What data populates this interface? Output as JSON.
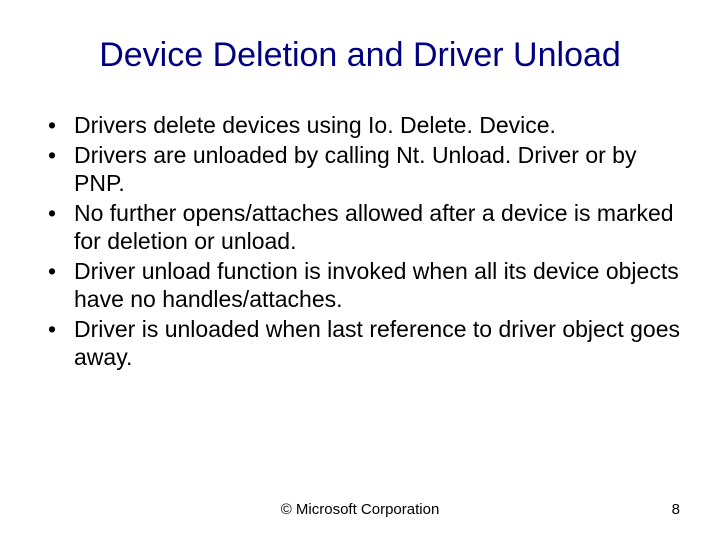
{
  "title": "Device Deletion and Driver Unload",
  "bullets": [
    "Drivers delete devices using Io. Delete. Device.",
    "Drivers are unloaded by calling Nt. Unload. Driver or by PNP.",
    "No further opens/attaches allowed after a device is marked for deletion or unload.",
    "Driver unload function is invoked when all its device objects have no handles/attaches.",
    "Driver is unloaded when last reference to driver object goes away."
  ],
  "footer": {
    "copyright": "© Microsoft Corporation",
    "page": "8"
  }
}
